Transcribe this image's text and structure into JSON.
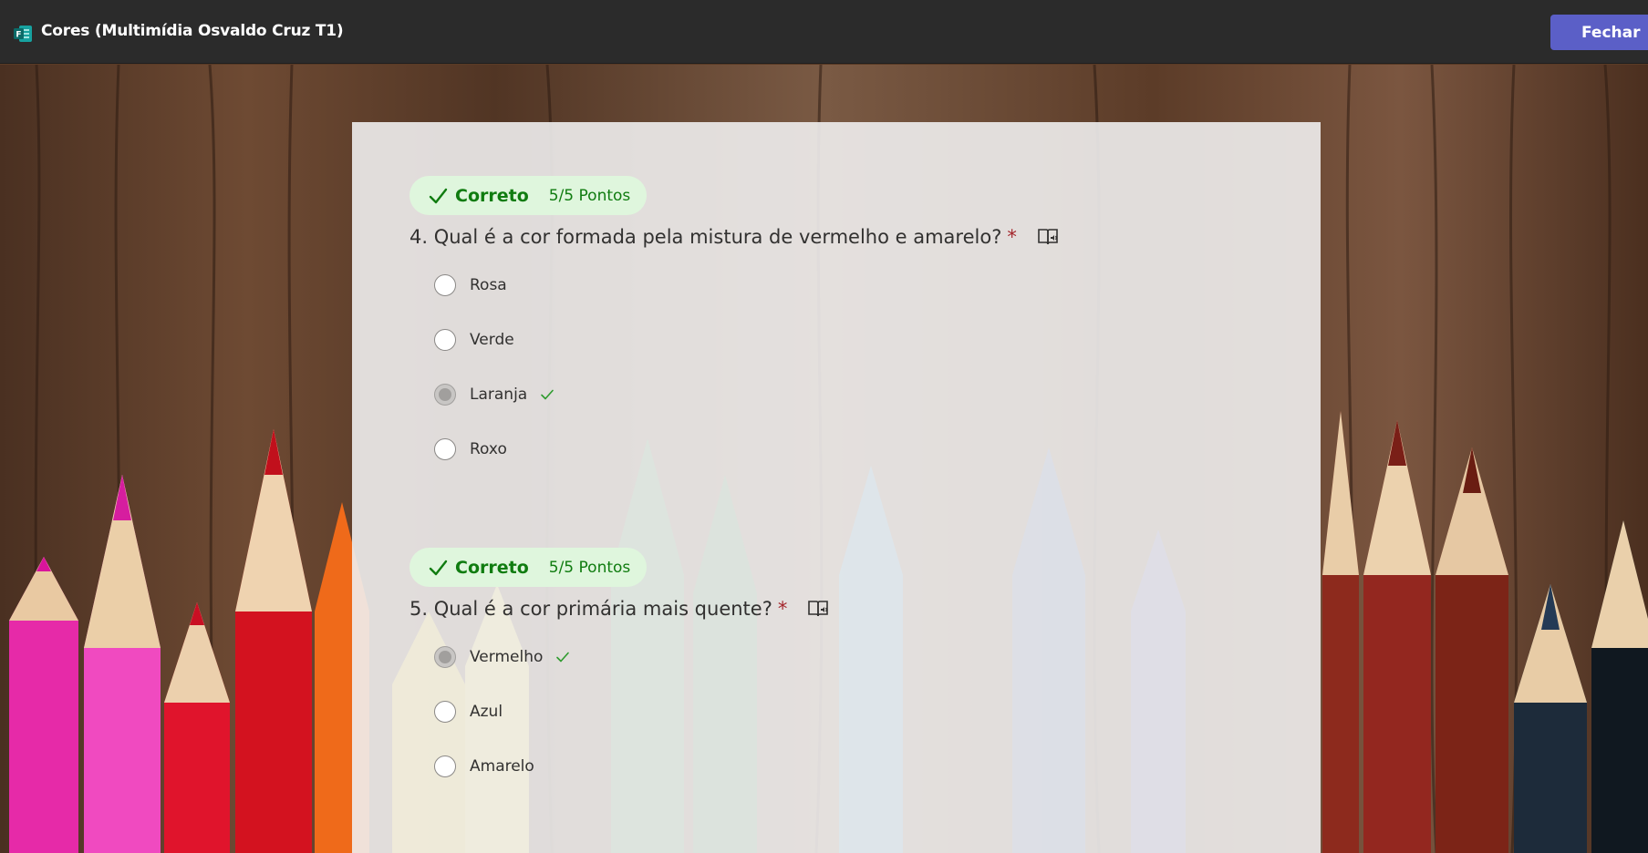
{
  "window": {
    "title": "Cores (Multimídia Osvaldo Cruz T1)",
    "close_label": "Fechar",
    "accent": "#5b5fc7"
  },
  "questions": [
    {
      "status": "Correto",
      "points": "5/5 Pontos",
      "text": "4. Qual é a cor formada pela mistura de vermelho e amarelo?",
      "required_mark": "*",
      "options": [
        "Rosa",
        "Verde",
        "Laranja",
        "Roxo"
      ],
      "selected": "Laranja"
    },
    {
      "status": "Correto",
      "points": "5/5 Pontos",
      "text": "5. Qual é a cor primária mais quente?",
      "required_mark": "*",
      "options": [
        "Vermelho",
        "Azul",
        "Amarelo"
      ],
      "selected": "Vermelho"
    }
  ],
  "colors": {
    "correct_green": "#107c10",
    "badge_bg": "#dff6dd",
    "required_red": "#a4262c"
  },
  "icons": {
    "app": "forms-app-icon",
    "correct": "checkmark-icon",
    "reader": "immersive-reader-icon"
  }
}
